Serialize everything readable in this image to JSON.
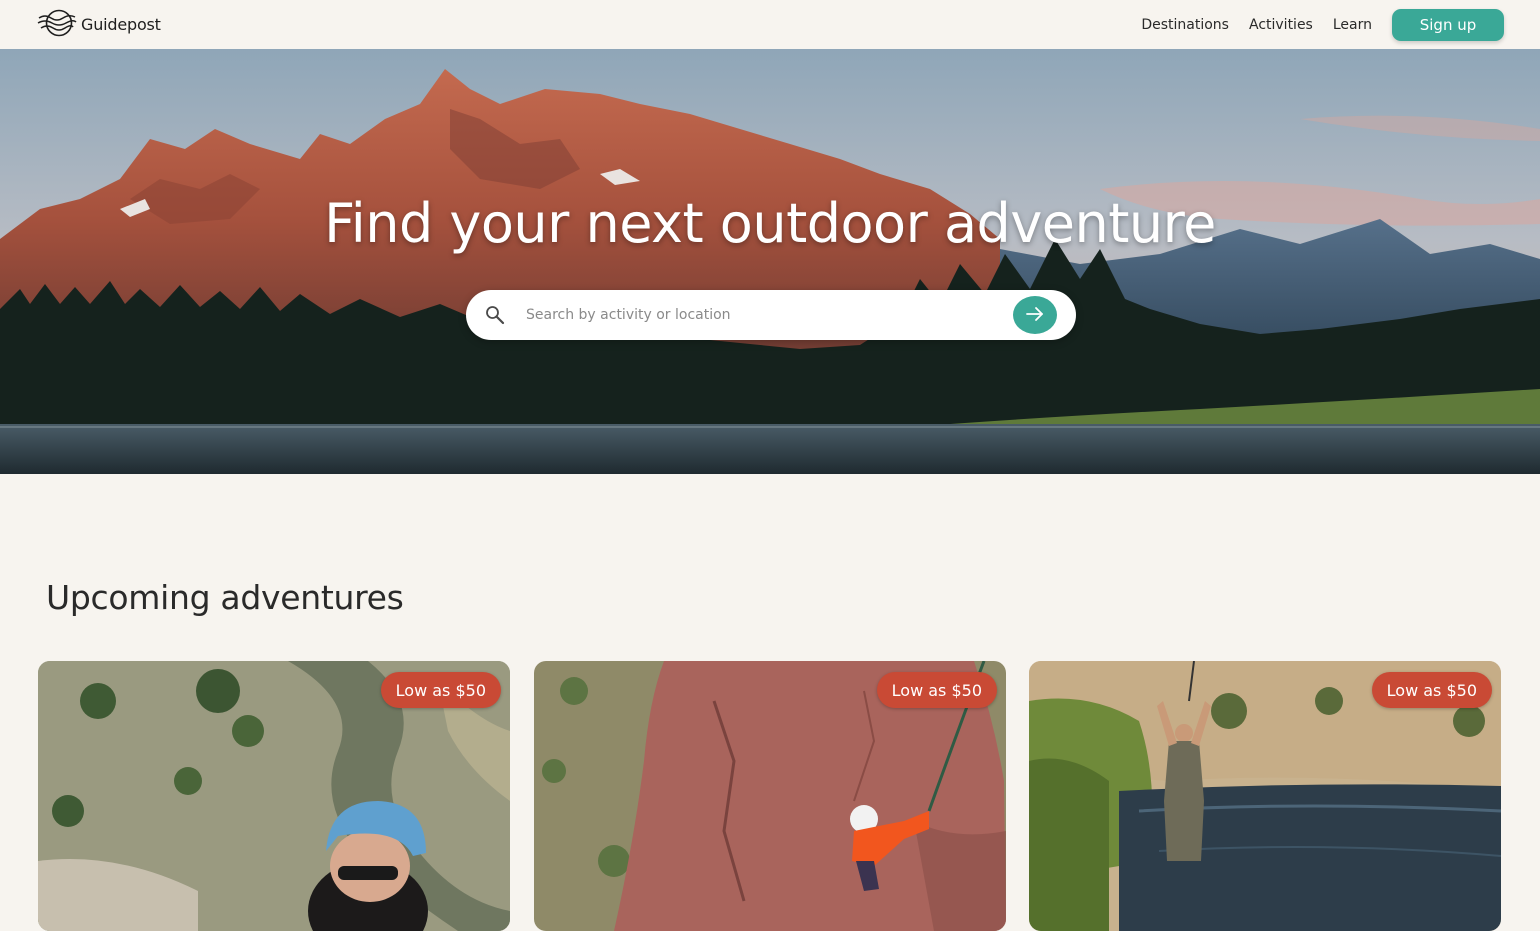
{
  "brand": {
    "name": "Guidepost",
    "logo_icon": "compass-waves-logo"
  },
  "nav": {
    "links": [
      {
        "label": "Destinations"
      },
      {
        "label": "Activities"
      },
      {
        "label": "Learn"
      }
    ],
    "signup_label": "Sign up"
  },
  "hero": {
    "title": "Find your next outdoor adventure",
    "image": "mountain-lake-landscape"
  },
  "search": {
    "placeholder": "Search by activity or location",
    "value": "",
    "icon": "search-icon",
    "submit_icon": "arrow-right-icon"
  },
  "section": {
    "title": "Upcoming adventures"
  },
  "cards": [
    {
      "price": "Low as $50",
      "image": "climber-with-blue-helmet-above-river"
    },
    {
      "price": "Low as $50",
      "image": "climber-on-red-rock-face"
    },
    {
      "price": "Low as $50",
      "image": "angler-in-river"
    }
  ],
  "colors": {
    "background": "#f7f4ef",
    "accent": "#3aa897",
    "badge": "#c94a35",
    "text": "#2a2a2a"
  }
}
